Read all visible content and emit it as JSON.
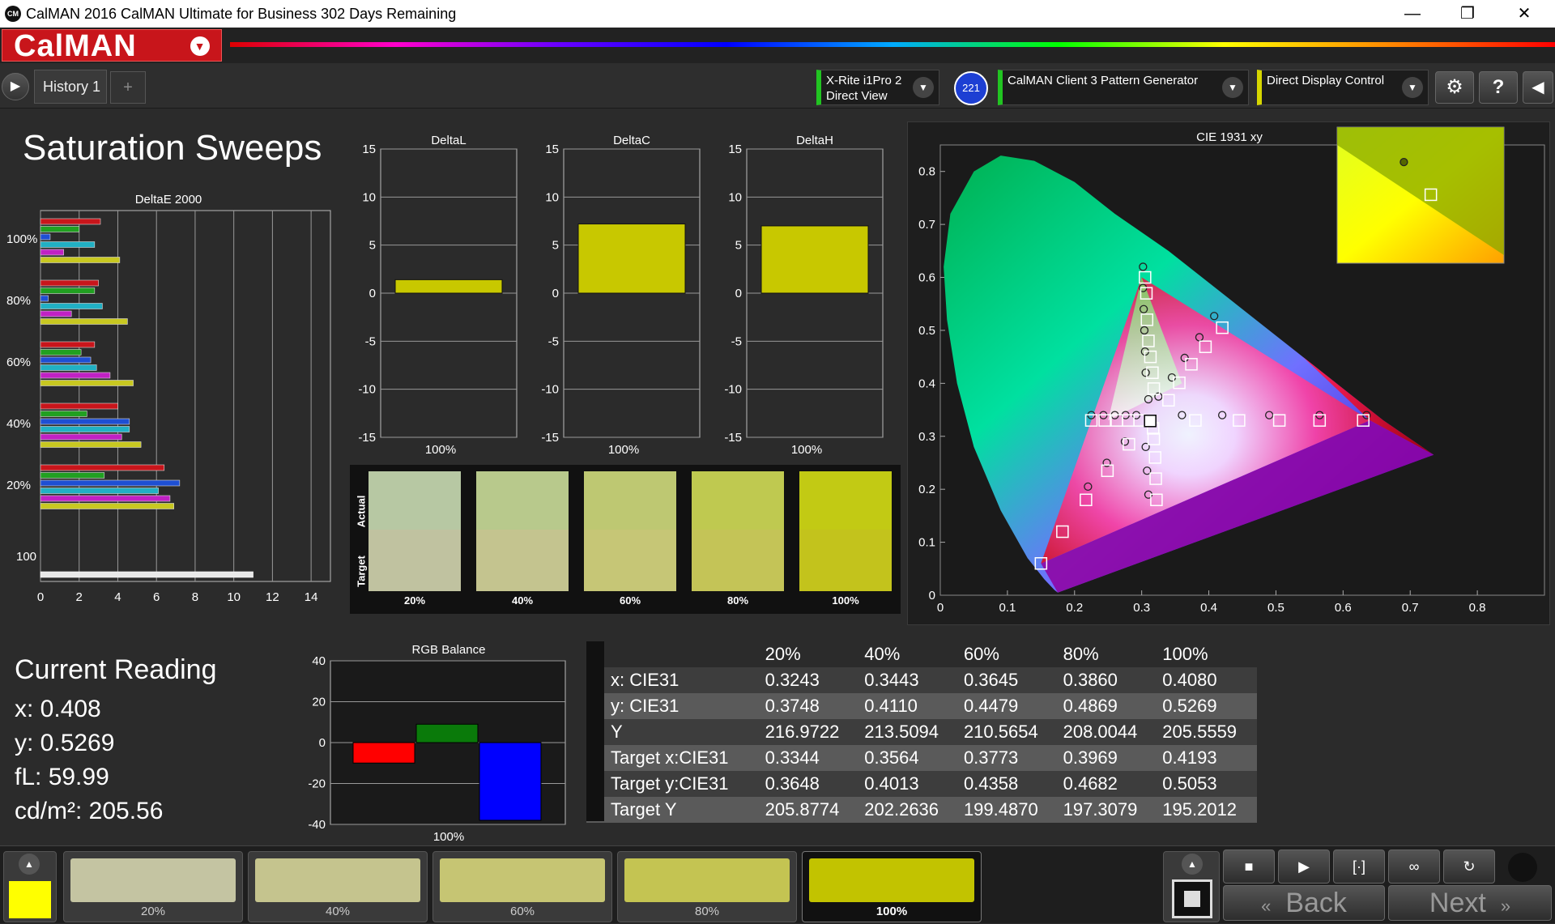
{
  "window": {
    "title": "CalMAN 2016 CalMAN Ultimate for Business 302 Days Remaining",
    "logo_text": "CM"
  },
  "brand": {
    "logo": "CalMAN"
  },
  "toolbar": {
    "history_tab": "History 1",
    "add_tab": "+",
    "meter": {
      "line1": "X-Rite i1Pro 2",
      "line2": "Direct View",
      "count": "221",
      "accent": "#21c421"
    },
    "pattern_generator": {
      "label": "CalMAN Client 3 Pattern Generator",
      "accent": "#21c421"
    },
    "display_control": {
      "label": "Direct Display Control",
      "accent": "#d7d700"
    },
    "icons": [
      "gear-icon",
      "help-icon",
      "collapse-icon"
    ]
  },
  "page": {
    "title": "Saturation Sweeps"
  },
  "deltae_chart": {
    "title": "DeltaE 2000",
    "x_ticks": [
      "0",
      "2",
      "4",
      "6",
      "8",
      "10",
      "12",
      "14"
    ],
    "group_labels": [
      "100%",
      "80%",
      "60%",
      "40%",
      "20%",
      "100"
    ],
    "groups": [
      [
        3.1,
        2.0,
        0.5,
        2.8,
        1.2,
        4.1
      ],
      [
        3.0,
        2.8,
        0.4,
        3.2,
        1.6,
        4.5
      ],
      [
        2.8,
        2.1,
        2.6,
        2.9,
        3.6,
        4.8
      ],
      [
        4.0,
        2.4,
        4.6,
        4.6,
        4.2,
        5.2
      ],
      [
        6.4,
        3.3,
        7.2,
        6.1,
        6.7,
        6.9
      ],
      [
        11.0
      ]
    ],
    "colors": [
      "#c8151b",
      "#21a021",
      "#1e4fd3",
      "#21b0c4",
      "#c021c4",
      "#c8c821"
    ],
    "gray": "#e8e8e8"
  },
  "delta_charts": [
    {
      "title": "DeltaL",
      "value": 1.4,
      "category": "100%"
    },
    {
      "title": "DeltaC",
      "value": 7.2,
      "category": "100%"
    },
    {
      "title": "DeltaH",
      "value": 7.0,
      "category": "100%"
    }
  ],
  "delta_axis": {
    "ticks": [
      "15",
      "10",
      "5",
      "0",
      "-5",
      "-10",
      "-15"
    ]
  },
  "swatches": {
    "actual_label": "Actual",
    "target_label": "Target",
    "items": [
      {
        "label": "20%",
        "actual": "#b7c8a3",
        "target": "#c0c2a0"
      },
      {
        "label": "40%",
        "actual": "#b8c98c",
        "target": "#c4c48f"
      },
      {
        "label": "60%",
        "actual": "#bec872",
        "target": "#c6c676"
      },
      {
        "label": "80%",
        "actual": "#bfc950",
        "target": "#c4c457"
      },
      {
        "label": "100%",
        "actual": "#c2ca14",
        "target": "#c3c31c"
      }
    ]
  },
  "cie_chart": {
    "title": "CIE 1931 xy",
    "x_ticks": [
      "0",
      "0.1",
      "0.2",
      "0.3",
      "0.4",
      "0.5",
      "0.6",
      "0.7",
      "0.8"
    ],
    "y_ticks": [
      "0",
      "0.1",
      "0.2",
      "0.3",
      "0.4",
      "0.5",
      "0.6",
      "0.7",
      "0.8"
    ],
    "gamut": [
      [
        0.64,
        0.33
      ],
      [
        0.3,
        0.6
      ],
      [
        0.15,
        0.06
      ]
    ],
    "white": [
      0.3127,
      0.329
    ],
    "target_points": [
      [
        0.305,
        0.6
      ],
      [
        0.307,
        0.57
      ],
      [
        0.308,
        0.52
      ],
      [
        0.31,
        0.48
      ],
      [
        0.313,
        0.45
      ],
      [
        0.316,
        0.42
      ],
      [
        0.318,
        0.39
      ],
      [
        0.42,
        0.505
      ],
      [
        0.395,
        0.469
      ],
      [
        0.374,
        0.436
      ],
      [
        0.356,
        0.401
      ],
      [
        0.34,
        0.368
      ],
      [
        0.63,
        0.33
      ],
      [
        0.565,
        0.33
      ],
      [
        0.505,
        0.33
      ],
      [
        0.445,
        0.33
      ],
      [
        0.38,
        0.33
      ],
      [
        0.15,
        0.06
      ],
      [
        0.182,
        0.12
      ],
      [
        0.217,
        0.18
      ],
      [
        0.249,
        0.235
      ],
      [
        0.281,
        0.285
      ],
      [
        0.322,
        0.18
      ],
      [
        0.321,
        0.22
      ],
      [
        0.32,
        0.26
      ],
      [
        0.318,
        0.295
      ],
      [
        0.317,
        0.315
      ],
      [
        0.225,
        0.33
      ],
      [
        0.245,
        0.33
      ],
      [
        0.263,
        0.33
      ],
      [
        0.28,
        0.33
      ],
      [
        0.297,
        0.33
      ]
    ],
    "actual_points": [
      [
        0.302,
        0.62
      ],
      [
        0.302,
        0.58
      ],
      [
        0.303,
        0.54
      ],
      [
        0.304,
        0.5
      ],
      [
        0.305,
        0.46
      ],
      [
        0.306,
        0.42
      ],
      [
        0.31,
        0.37
      ],
      [
        0.408,
        0.527
      ],
      [
        0.386,
        0.487
      ],
      [
        0.364,
        0.448
      ],
      [
        0.345,
        0.411
      ],
      [
        0.325,
        0.375
      ],
      [
        0.635,
        0.34
      ],
      [
        0.565,
        0.34
      ],
      [
        0.49,
        0.34
      ],
      [
        0.42,
        0.34
      ],
      [
        0.36,
        0.34
      ],
      [
        0.22,
        0.205
      ],
      [
        0.248,
        0.25
      ],
      [
        0.275,
        0.29
      ],
      [
        0.31,
        0.19
      ],
      [
        0.308,
        0.235
      ],
      [
        0.306,
        0.28
      ],
      [
        0.225,
        0.34
      ],
      [
        0.243,
        0.34
      ],
      [
        0.26,
        0.34
      ],
      [
        0.276,
        0.34
      ],
      [
        0.292,
        0.34
      ]
    ],
    "inset_target": [
      0.4193,
      0.5053
    ],
    "inset_actual": [
      0.408,
      0.5269
    ]
  },
  "current_reading": {
    "heading": "Current Reading",
    "x": "x: 0.408",
    "y": "y: 0.5269",
    "fl": "fL: 59.99",
    "cd": "cd/m²: 205.56"
  },
  "rgb_balance": {
    "title": "RGB Balance",
    "ticks": [
      "40",
      "20",
      "0",
      "-20",
      "-40"
    ],
    "category": "100%",
    "values": {
      "red": -10,
      "green": 9,
      "blue": -38
    },
    "colors": {
      "red": "#ff0000",
      "green": "#0a7a0a",
      "blue": "#0000ff"
    }
  },
  "table": {
    "columns": [
      "20%",
      "40%",
      "60%",
      "80%",
      "100%"
    ],
    "rows": [
      {
        "label": "x: CIE31",
        "values": [
          "0.3243",
          "0.3443",
          "0.3645",
          "0.3860",
          "0.4080"
        ]
      },
      {
        "label": "y: CIE31",
        "values": [
          "0.3748",
          "0.4110",
          "0.4479",
          "0.4869",
          "0.5269"
        ]
      },
      {
        "label": "Y",
        "values": [
          "216.9722",
          "213.5094",
          "210.5654",
          "208.0044",
          "205.5559"
        ]
      },
      {
        "label": "Target x:CIE31",
        "values": [
          "0.3344",
          "0.3564",
          "0.3773",
          "0.3969",
          "0.4193"
        ]
      },
      {
        "label": "Target y:CIE31",
        "values": [
          "0.3648",
          "0.4013",
          "0.4358",
          "0.4682",
          "0.5053"
        ]
      },
      {
        "label": "Target Y",
        "values": [
          "205.8774",
          "202.2636",
          "199.4870",
          "197.3079",
          "195.2012"
        ]
      }
    ]
  },
  "bottom": {
    "current_color": "#ffff00",
    "steps": [
      {
        "label": "20%",
        "color": "#c4c4a2",
        "selected": false
      },
      {
        "label": "40%",
        "color": "#c5c48e",
        "selected": false
      },
      {
        "label": "60%",
        "color": "#c6c573",
        "selected": false
      },
      {
        "label": "80%",
        "color": "#c4c452",
        "selected": false
      },
      {
        "label": "100%",
        "color": "#c2c300",
        "selected": true
      }
    ],
    "back_label": "Back",
    "next_label": "Next"
  }
}
